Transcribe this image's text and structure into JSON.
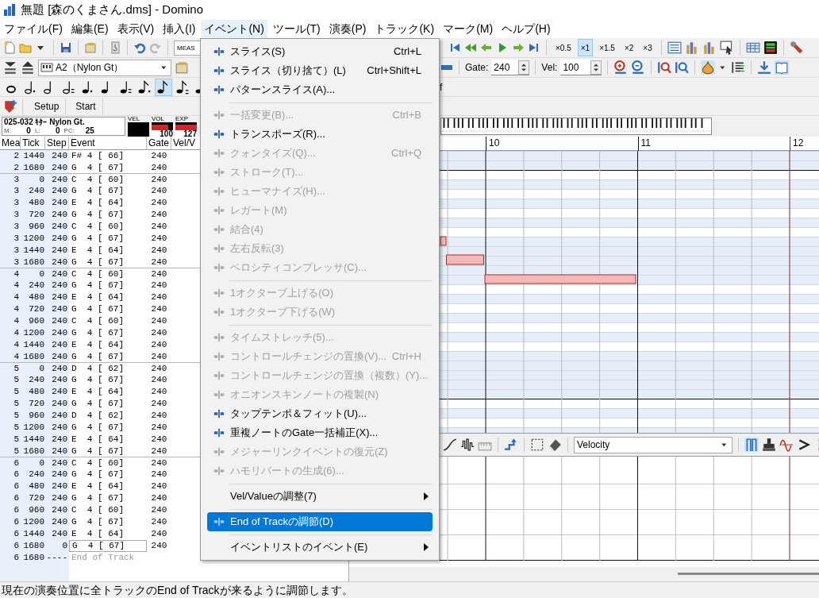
{
  "window": {
    "title": "無題 [森のくまさん.dms] - Domino"
  },
  "menu_bar": [
    {
      "label": "ファイル(F)",
      "selected": false
    },
    {
      "label": "編集(E)",
      "selected": false
    },
    {
      "label": "表示(V)",
      "selected": false
    },
    {
      "label": "挿入(I)",
      "selected": false
    },
    {
      "label": "イベント(N)",
      "selected": true
    },
    {
      "label": "ツール(T)",
      "selected": false
    },
    {
      "label": "演奏(P)",
      "selected": false
    },
    {
      "label": "トラック(K)",
      "selected": false
    },
    {
      "label": "マーク(M)",
      "selected": false
    },
    {
      "label": "ヘルプ(H)",
      "selected": false
    }
  ],
  "toolbar": {
    "measure_field": "MEAS",
    "instrument": "A2（Nylon Gt）",
    "gate_label": "Gate:",
    "gate": "240",
    "vel_label": "Vel:",
    "velocity": "100",
    "speeds": [
      {
        "label": "×0.5",
        "selected": false
      },
      {
        "label": "×1",
        "selected": true
      },
      {
        "label": "×1.5",
        "selected": false
      },
      {
        "label": "×2",
        "selected": false
      },
      {
        "label": "×3",
        "selected": false
      }
    ],
    "note_lengths": [
      {
        "selected": false
      },
      {
        "selected": false
      },
      {
        "selected": false
      },
      {
        "selected": false
      },
      {
        "selected": false
      },
      {
        "selected": false
      },
      {
        "selected": false
      },
      {
        "selected": false
      },
      {
        "selected": true
      },
      {
        "selected": false
      },
      {
        "selected": false
      }
    ],
    "cut_text": "f",
    "buttons": [
      "Setup",
      "Start"
    ]
  },
  "track_info": {
    "name": "025-032 ｷﾀｰ Nylon Gt.",
    "m_label": "M:",
    "m": "0",
    "l_label": "L:",
    "l": "0",
    "pc_label": "PC:",
    "pc": "25",
    "meters": [
      {
        "label": "VEL",
        "level": 0
      },
      {
        "label": "VOL",
        "reading": "100",
        "level": 0.79
      },
      {
        "label": "EXP",
        "reading": "127",
        "level": 1
      }
    ]
  },
  "event_list": {
    "columns": [
      "Mea",
      "Tick",
      "Step",
      "Event",
      "Gate",
      "Vel/V"
    ],
    "rows": [
      {
        "mea": "2",
        "tick": "1440",
        "step": "240",
        "event": "F# 4 [ 66]",
        "gate": "240",
        "kind": "note",
        "editing": false
      },
      {
        "mea": "2",
        "tick": "1680",
        "step": "240",
        "event": "G  4 [ 67]",
        "gate": "240",
        "kind": "note",
        "editing": false
      },
      {
        "mea": "3",
        "tick": "0",
        "step": "240",
        "event": "C  4 [ 60]",
        "gate": "240",
        "kind": "note",
        "editing": false
      },
      {
        "mea": "3",
        "tick": "240",
        "step": "240",
        "event": "G  4 [ 67]",
        "gate": "240",
        "kind": "note",
        "editing": false
      },
      {
        "mea": "3",
        "tick": "480",
        "step": "240",
        "event": "E  4 [ 64]",
        "gate": "240",
        "kind": "note",
        "editing": false
      },
      {
        "mea": "3",
        "tick": "720",
        "step": "240",
        "event": "G  4 [ 67]",
        "gate": "240",
        "kind": "note",
        "editing": false
      },
      {
        "mea": "3",
        "tick": "960",
        "step": "240",
        "event": "C  4 [ 60]",
        "gate": "240",
        "kind": "note",
        "editing": false
      },
      {
        "mea": "3",
        "tick": "1200",
        "step": "240",
        "event": "G  4 [ 67]",
        "gate": "240",
        "kind": "note",
        "editing": false
      },
      {
        "mea": "3",
        "tick": "1440",
        "step": "240",
        "event": "E  4 [ 64]",
        "gate": "240",
        "kind": "note",
        "editing": false
      },
      {
        "mea": "3",
        "tick": "1680",
        "step": "240",
        "event": "G  4 [ 67]",
        "gate": "240",
        "kind": "note",
        "editing": false
      },
      {
        "mea": "4",
        "tick": "0",
        "step": "240",
        "event": "C  4 [ 60]",
        "gate": "240",
        "kind": "note",
        "editing": false
      },
      {
        "mea": "4",
        "tick": "240",
        "step": "240",
        "event": "G  4 [ 67]",
        "gate": "240",
        "kind": "note",
        "editing": false
      },
      {
        "mea": "4",
        "tick": "480",
        "step": "240",
        "event": "E  4 [ 64]",
        "gate": "240",
        "kind": "note",
        "editing": false
      },
      {
        "mea": "4",
        "tick": "720",
        "step": "240",
        "event": "G  4 [ 67]",
        "gate": "240",
        "kind": "note",
        "editing": false
      },
      {
        "mea": "4",
        "tick": "960",
        "step": "240",
        "event": "C  4 [ 60]",
        "gate": "240",
        "kind": "note",
        "editing": false
      },
      {
        "mea": "4",
        "tick": "1200",
        "step": "240",
        "event": "G  4 [ 67]",
        "gate": "240",
        "kind": "note",
        "editing": false
      },
      {
        "mea": "4",
        "tick": "1440",
        "step": "240",
        "event": "E  4 [ 64]",
        "gate": "240",
        "kind": "note",
        "editing": false
      },
      {
        "mea": "4",
        "tick": "1680",
        "step": "240",
        "event": "G  4 [ 67]",
        "gate": "240",
        "kind": "note",
        "editing": false
      },
      {
        "mea": "5",
        "tick": "0",
        "step": "240",
        "event": "D  4 [ 62]",
        "gate": "240",
        "kind": "note",
        "editing": false
      },
      {
        "mea": "5",
        "tick": "240",
        "step": "240",
        "event": "G  4 [ 67]",
        "gate": "240",
        "kind": "note",
        "editing": false
      },
      {
        "mea": "5",
        "tick": "480",
        "step": "240",
        "event": "E  4 [ 64]",
        "gate": "240",
        "kind": "note",
        "editing": false
      },
      {
        "mea": "5",
        "tick": "720",
        "step": "240",
        "event": "G  4 [ 67]",
        "gate": "240",
        "kind": "note",
        "editing": false
      },
      {
        "mea": "5",
        "tick": "960",
        "step": "240",
        "event": "D  4 [ 62]",
        "gate": "240",
        "kind": "note",
        "editing": false
      },
      {
        "mea": "5",
        "tick": "1200",
        "step": "240",
        "event": "G  4 [ 67]",
        "gate": "240",
        "kind": "note",
        "editing": false
      },
      {
        "mea": "5",
        "tick": "1440",
        "step": "240",
        "event": "E  4 [ 64]",
        "gate": "240",
        "kind": "note",
        "editing": false
      },
      {
        "mea": "5",
        "tick": "1680",
        "step": "240",
        "event": "G  4 [ 67]",
        "gate": "240",
        "kind": "note",
        "editing": false
      },
      {
        "mea": "6",
        "tick": "0",
        "step": "240",
        "event": "C  4 [ 60]",
        "gate": "240",
        "kind": "note",
        "editing": false
      },
      {
        "mea": "6",
        "tick": "240",
        "step": "240",
        "event": "G  4 [ 67]",
        "gate": "240",
        "kind": "note",
        "editing": false
      },
      {
        "mea": "6",
        "tick": "480",
        "step": "240",
        "event": "E  4 [ 64]",
        "gate": "240",
        "kind": "note",
        "editing": false
      },
      {
        "mea": "6",
        "tick": "720",
        "step": "240",
        "event": "G  4 [ 67]",
        "gate": "240",
        "kind": "note",
        "editing": false
      },
      {
        "mea": "6",
        "tick": "960",
        "step": "240",
        "event": "C  4 [ 60]",
        "gate": "240",
        "kind": "note",
        "editing": false
      },
      {
        "mea": "6",
        "tick": "1200",
        "step": "240",
        "event": "G  4 [ 67]",
        "gate": "240",
        "kind": "note",
        "editing": false
      },
      {
        "mea": "6",
        "tick": "1440",
        "step": "240",
        "event": "E  4 [ 64]",
        "gate": "240",
        "kind": "note",
        "editing": false
      },
      {
        "mea": "6",
        "tick": "1680",
        "step": "0",
        "event": "G  4 [ 67]",
        "gate": "240",
        "kind": "note",
        "editing": true
      },
      {
        "mea": "6",
        "tick": "1680",
        "step": "----",
        "event": "End of Track",
        "kind": "end",
        "editing": false
      }
    ]
  },
  "piano_roll": {
    "ruler": [
      "10",
      "11",
      "12"
    ]
  },
  "controller_bar": {
    "controller": "Velocity"
  },
  "event_menu": {
    "items": [
      {
        "kind": "item",
        "label": "スライス(S)",
        "shortcut": "Ctrl+L",
        "icon": true,
        "disabled": false,
        "selected": false,
        "submenu": false
      },
      {
        "kind": "item",
        "label": "スライス（切り捨て）(L)",
        "shortcut": "Ctrl+Shift+L",
        "icon": true,
        "disabled": false,
        "selected": false,
        "submenu": false
      },
      {
        "kind": "item",
        "label": "パターンスライス(A)...",
        "icon": true,
        "disabled": false,
        "selected": false,
        "submenu": false
      },
      {
        "kind": "separator"
      },
      {
        "kind": "item",
        "label": "一括変更(B)...",
        "shortcut": "Ctrl+B",
        "icon": true,
        "disabled": true,
        "selected": false,
        "submenu": false
      },
      {
        "kind": "item",
        "label": "トランスポーズ(R)...",
        "icon": true,
        "disabled": false,
        "selected": false,
        "submenu": false
      },
      {
        "kind": "item",
        "label": "クォンタイズ(Q)...",
        "shortcut": "Ctrl+Q",
        "icon": true,
        "disabled": true,
        "selected": false,
        "submenu": false
      },
      {
        "kind": "item",
        "label": "ストローク(T)...",
        "icon": true,
        "disabled": true,
        "selected": false,
        "submenu": false
      },
      {
        "kind": "item",
        "label": "ヒューマナイズ(H)...",
        "icon": true,
        "disabled": true,
        "selected": false,
        "submenu": false
      },
      {
        "kind": "item",
        "label": "レガート(M)",
        "icon": true,
        "disabled": true,
        "selected": false,
        "submenu": false
      },
      {
        "kind": "item",
        "label": "結合(4)",
        "icon": true,
        "disabled": true,
        "selected": false,
        "submenu": false
      },
      {
        "kind": "item",
        "label": "左右反転(3)",
        "icon": true,
        "disabled": true,
        "selected": false,
        "submenu": false
      },
      {
        "kind": "item",
        "label": "ベロシティコンプレッサ(C)...",
        "icon": true,
        "disabled": true,
        "selected": false,
        "submenu": false
      },
      {
        "kind": "separator"
      },
      {
        "kind": "item",
        "label": "1オクターブ上げる(O)",
        "icon": true,
        "disabled": true,
        "selected": false,
        "submenu": false
      },
      {
        "kind": "item",
        "label": "1オクターブ下げる(W)",
        "icon": true,
        "disabled": true,
        "selected": false,
        "submenu": false
      },
      {
        "kind": "separator"
      },
      {
        "kind": "item",
        "label": "タイムストレッチ(5)...",
        "icon": true,
        "disabled": true,
        "selected": false,
        "submenu": false
      },
      {
        "kind": "item",
        "label": "コントロールチェンジの置換(V)...",
        "shortcut": "Ctrl+H",
        "icon": true,
        "disabled": true,
        "selected": false,
        "submenu": false
      },
      {
        "kind": "item",
        "label": "コントロールチェンジの置換（複数）(Y)...",
        "icon": true,
        "disabled": true,
        "selected": false,
        "submenu": false
      },
      {
        "kind": "item",
        "label": "オニオンスキンノートの複製(N)",
        "icon": true,
        "disabled": true,
        "selected": false,
        "submenu": false
      },
      {
        "kind": "item",
        "label": "タップテンポ＆フィット(U)...",
        "icon": true,
        "disabled": false,
        "selected": false,
        "submenu": false
      },
      {
        "kind": "item",
        "label": "重複ノートのGate一括補正(X)...",
        "icon": true,
        "disabled": false,
        "selected": false,
        "submenu": false
      },
      {
        "kind": "item",
        "label": "メジャーリンクイベントの復元(Z)",
        "icon": true,
        "disabled": true,
        "selected": false,
        "submenu": false
      },
      {
        "kind": "item",
        "label": "ハモリパートの生成(6)...",
        "icon": true,
        "disabled": true,
        "selected": false,
        "submenu": false
      },
      {
        "kind": "separator"
      },
      {
        "kind": "item",
        "label": "Vel/Valueの調整(7)",
        "icon": false,
        "disabled": false,
        "selected": false,
        "submenu": true
      },
      {
        "kind": "separator"
      },
      {
        "kind": "item",
        "label": "End of Trackの調節(D)",
        "icon": true,
        "disabled": false,
        "selected": true,
        "submenu": false
      },
      {
        "kind": "separator"
      },
      {
        "kind": "item",
        "label": "イベントリストのイベント(E)",
        "icon": false,
        "disabled": false,
        "selected": false,
        "submenu": true
      }
    ]
  },
  "status_bar": {
    "text": "現在の演奏位置に全トラックのEnd of Trackが来るように調節します。"
  }
}
